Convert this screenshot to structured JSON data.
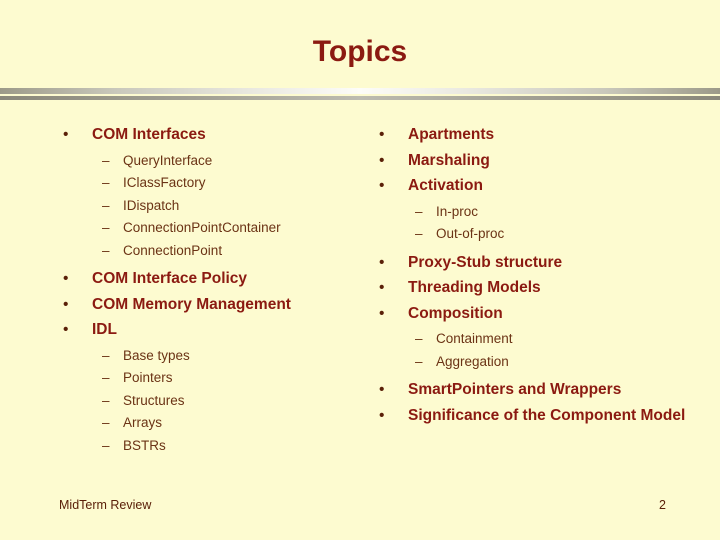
{
  "slide": {
    "title": "Topics",
    "background_color": "#FDFBD0",
    "heading_color": "#8B1A11",
    "body_color": "#6b3315",
    "bullet_glyph": "•",
    "dash_glyph": "–"
  },
  "left_column": [
    {
      "level": 1,
      "text": "COM Interfaces"
    },
    {
      "level": 2,
      "text": "QueryInterface"
    },
    {
      "level": 2,
      "text": "IClassFactory"
    },
    {
      "level": 2,
      "text": "IDispatch"
    },
    {
      "level": 2,
      "text": "ConnectionPointContainer"
    },
    {
      "level": 2,
      "text": "ConnectionPoint"
    },
    {
      "level": 1,
      "text": "COM Interface Policy"
    },
    {
      "level": 1,
      "text": "COM Memory Management"
    },
    {
      "level": 1,
      "text": "IDL"
    },
    {
      "level": 2,
      "text": "Base types"
    },
    {
      "level": 2,
      "text": "Pointers"
    },
    {
      "level": 2,
      "text": "Structures"
    },
    {
      "level": 2,
      "text": "Arrays"
    },
    {
      "level": 2,
      "text": "BSTRs"
    }
  ],
  "right_column": [
    {
      "level": 1,
      "text": "Apartments"
    },
    {
      "level": 1,
      "text": "Marshaling"
    },
    {
      "level": 1,
      "text": "Activation"
    },
    {
      "level": 2,
      "text": "In-proc"
    },
    {
      "level": 2,
      "text": "Out-of-proc"
    },
    {
      "level": 1,
      "text": "Proxy-Stub structure"
    },
    {
      "level": 1,
      "text": "Threading Models"
    },
    {
      "level": 1,
      "text": "Composition"
    },
    {
      "level": 2,
      "text": "Containment"
    },
    {
      "level": 2,
      "text": "Aggregation"
    },
    {
      "level": 1,
      "text": "SmartPointers and Wrappers"
    },
    {
      "level": 1,
      "text": "Significance of the Component Model"
    }
  ],
  "footer": {
    "left_text": "MidTerm Review",
    "page_number": "2"
  }
}
